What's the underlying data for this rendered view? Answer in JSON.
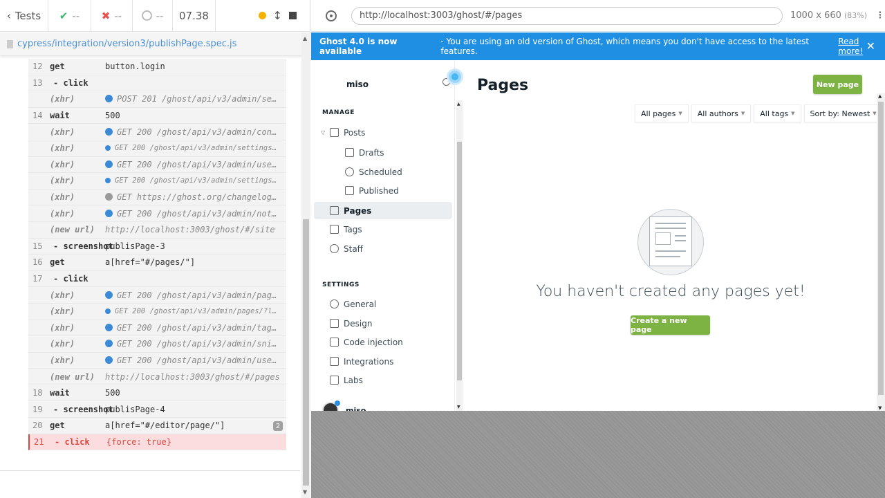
{
  "reporter": {
    "header": {
      "tests_label": "Tests",
      "passed": "--",
      "failed": "--",
      "pending": "--",
      "duration": "07.38"
    },
    "spec_path": "cypress/integration/version3/publishPage.spec.js",
    "commands": [
      {
        "num": "12",
        "name": "get",
        "msg": "button.login",
        "kind": "cmd"
      },
      {
        "num": "13",
        "name": "- click",
        "msg": "",
        "kind": "child"
      },
      {
        "num": "",
        "name": "(xhr)",
        "msg": "POST 201 /ghost/api/v3/admin/se…",
        "kind": "xhr",
        "dot": "blue"
      },
      {
        "num": "14",
        "name": "wait",
        "msg": "500",
        "kind": "cmd"
      },
      {
        "num": "",
        "name": "(xhr)",
        "msg": "GET 200 /ghost/api/v3/admin/con…",
        "kind": "xhr",
        "dot": "blue"
      },
      {
        "num": "",
        "name": "(xhr)",
        "msg": "GET 200 /ghost/api/v3/admin/settings/…",
        "kind": "xhr-small",
        "dot": "blue"
      },
      {
        "num": "",
        "name": "(xhr)",
        "msg": "GET 200 /ghost/api/v3/admin/use…",
        "kind": "xhr",
        "dot": "blue"
      },
      {
        "num": "",
        "name": "(xhr)",
        "msg": "GET 200 /ghost/api/v3/admin/settings/…",
        "kind": "xhr-small",
        "dot": "blue"
      },
      {
        "num": "",
        "name": "(xhr)",
        "msg": "GET https://ghost.org/changelog…",
        "kind": "xhr",
        "dot": "gray"
      },
      {
        "num": "",
        "name": "(xhr)",
        "msg": "GET 200 /ghost/api/v3/admin/not…",
        "kind": "xhr",
        "dot": "blue"
      },
      {
        "num": "",
        "name": "(new url)",
        "msg": "http://localhost:3003/ghost/#/site",
        "kind": "url"
      },
      {
        "num": "15",
        "name": "- screenshot",
        "msg": "publisPage-3",
        "kind": "child"
      },
      {
        "num": "16",
        "name": "get",
        "msg": "a[href=\"#/pages/\"]",
        "kind": "cmd"
      },
      {
        "num": "17",
        "name": "- click",
        "msg": "",
        "kind": "child"
      },
      {
        "num": "",
        "name": "(xhr)",
        "msg": "GET 200 /ghost/api/v3/admin/pag…",
        "kind": "xhr",
        "dot": "blue"
      },
      {
        "num": "",
        "name": "(xhr)",
        "msg": "GET 200 /ghost/api/v3/admin/pages/?li…",
        "kind": "xhr-small",
        "dot": "blue"
      },
      {
        "num": "",
        "name": "(xhr)",
        "msg": "GET 200 /ghost/api/v3/admin/tag…",
        "kind": "xhr",
        "dot": "blue"
      },
      {
        "num": "",
        "name": "(xhr)",
        "msg": "GET 200 /ghost/api/v3/admin/sni…",
        "kind": "xhr",
        "dot": "blue"
      },
      {
        "num": "",
        "name": "(xhr)",
        "msg": "GET 200 /ghost/api/v3/admin/use…",
        "kind": "xhr",
        "dot": "blue"
      },
      {
        "num": "",
        "name": "(new url)",
        "msg": "http://localhost:3003/ghost/#/pages",
        "kind": "url"
      },
      {
        "num": "18",
        "name": "wait",
        "msg": "500",
        "kind": "cmd"
      },
      {
        "num": "19",
        "name": "- screenshot",
        "msg": "publisPage-4",
        "kind": "child"
      },
      {
        "num": "20",
        "name": "get",
        "msg": "a[href=\"#/editor/page/\"]",
        "kind": "cmd",
        "badge": "2"
      },
      {
        "num": "21",
        "name": "- click",
        "msg": "{force: true}",
        "kind": "failed"
      }
    ]
  },
  "aut": {
    "url": "http://localhost:3003/ghost/#/pages",
    "viewport": "1000 x 660",
    "scale": "(83%)",
    "banner": {
      "title": "Ghost 4.0 is now available",
      "text": " - You are using an old version of Ghost, which means you don't have access to the latest features.",
      "link": "Read more!",
      "close": "✕"
    },
    "sidebar": {
      "brand": "miso",
      "manage_label": "MANAGE",
      "settings_label": "SETTINGS",
      "posts": "Posts",
      "drafts": "Drafts",
      "scheduled": "Scheduled",
      "published": "Published",
      "pages": "Pages",
      "tags": "Tags",
      "staff": "Staff",
      "general": "General",
      "design": "Design",
      "code_injection": "Code injection",
      "integrations": "Integrations",
      "labs": "Labs",
      "user": "miso"
    },
    "main": {
      "title": "Pages",
      "new_button": "New page",
      "filters": [
        "All pages",
        "All authors",
        "All tags",
        "Sort by: Newest"
      ],
      "empty_text": "You haven't created any pages yet!",
      "create_button": "Create a new page"
    },
    "colors": {
      "banner": "#1f8fe3",
      "accent_green": "#7cb342",
      "failed_red": "#d8473c"
    }
  }
}
